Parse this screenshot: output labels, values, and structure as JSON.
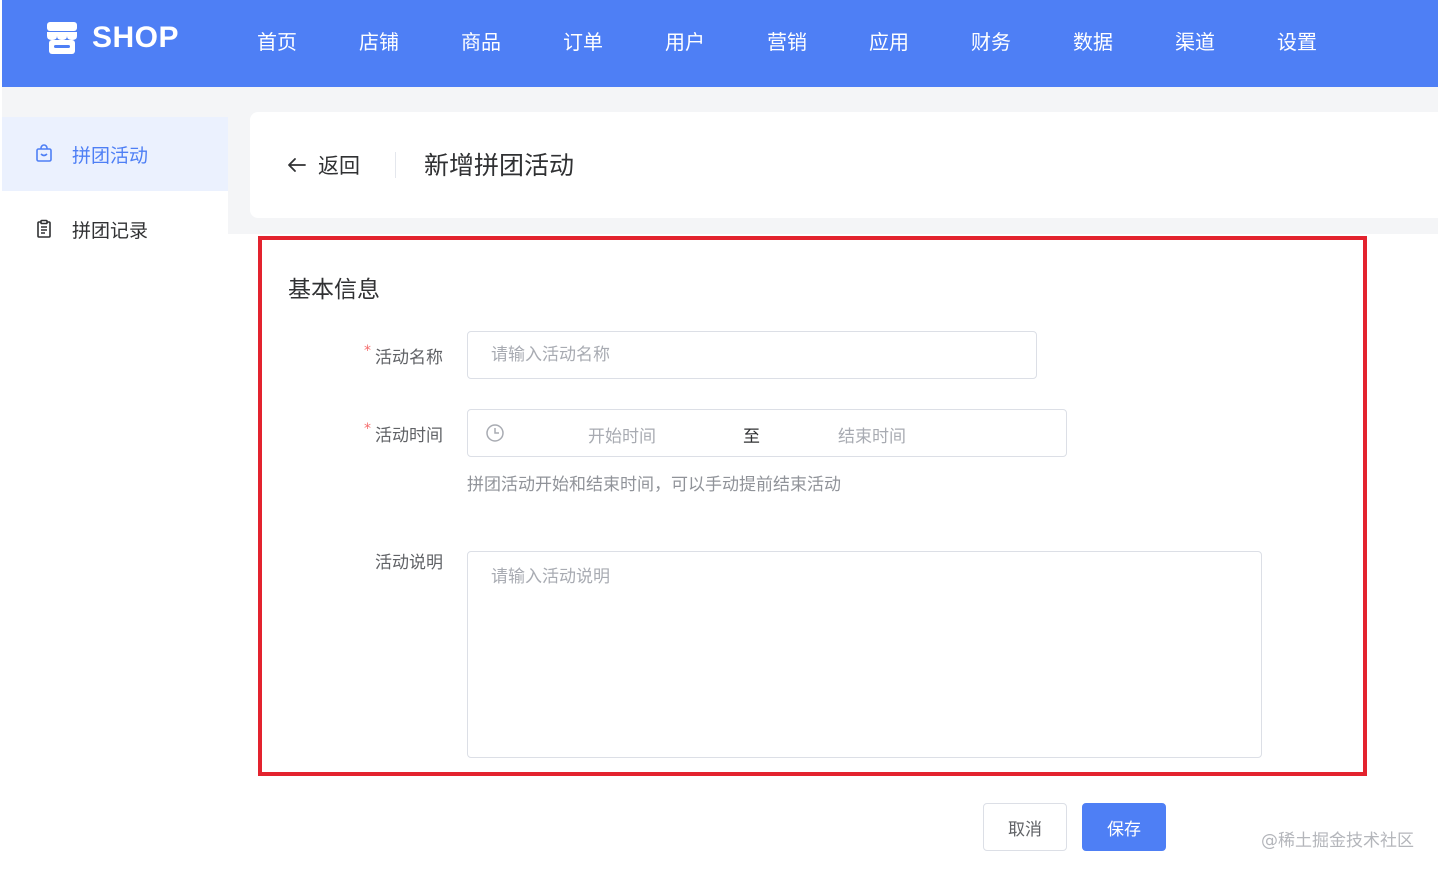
{
  "brand": {
    "name": "SHOP",
    "icon": "store-icon"
  },
  "nav": [
    {
      "label": "首页"
    },
    {
      "label": "店铺"
    },
    {
      "label": "商品"
    },
    {
      "label": "订单"
    },
    {
      "label": "用户"
    },
    {
      "label": "营销"
    },
    {
      "label": "应用"
    },
    {
      "label": "财务"
    },
    {
      "label": "数据"
    },
    {
      "label": "渠道"
    },
    {
      "label": "设置"
    }
  ],
  "sidebar": {
    "items": [
      {
        "label": "拼团活动",
        "icon": "shopping-bag-icon",
        "active": true
      },
      {
        "label": "拼团记录",
        "icon": "clipboard-icon",
        "active": false
      }
    ]
  },
  "header": {
    "back_label": "返回",
    "title": "新增拼团活动"
  },
  "form": {
    "section_title": "基本信息",
    "name": {
      "label": "活动名称",
      "placeholder": "请输入活动名称",
      "required": true
    },
    "time": {
      "label": "活动时间",
      "required": true,
      "start_placeholder": "开始时间",
      "separator": "至",
      "end_placeholder": "结束时间",
      "hint": "拼团活动开始和结束时间，可以手动提前结束活动"
    },
    "description": {
      "label": "活动说明",
      "placeholder": "请输入活动说明"
    }
  },
  "footer": {
    "cancel_label": "取消",
    "save_label": "保存"
  },
  "watermark": "@稀土掘金技术社区",
  "colors": {
    "primary": "#4e7ff5",
    "highlight": "#e3232e",
    "required": "#f56c6c"
  }
}
